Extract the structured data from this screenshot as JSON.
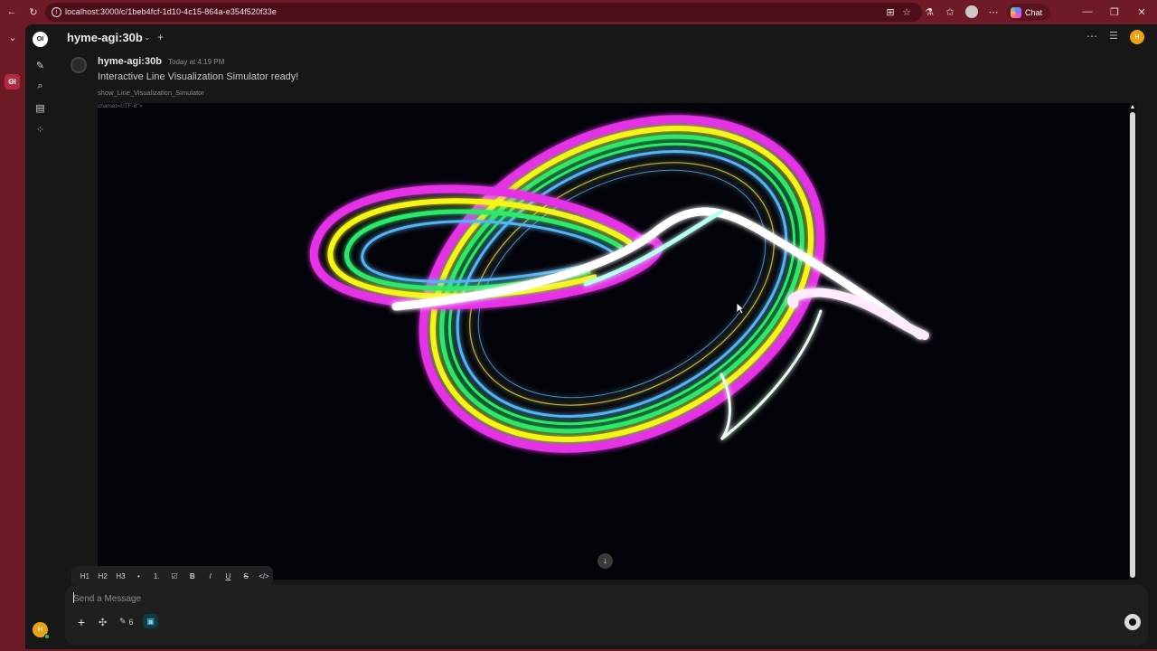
{
  "browser": {
    "url": "localhost:3000/c/1beb4fcf-1d10-4c15-864a-e354f520f33e",
    "chat_button": "Chat",
    "info_icon": "info-icon",
    "back_icon": "back-arrow-icon",
    "refresh_icon": "refresh-icon"
  },
  "header": {
    "model_name": "hyme-agi:30b",
    "user_initial": "H"
  },
  "message": {
    "author": "hyme-agi:30b",
    "time": "Today at 4:19 PM",
    "text": "Interactive Line Visualization Simulator ready!",
    "sub_label": "show_Line_Visualization_Simulator",
    "code_snippet": "charset=UTF-8\">"
  },
  "sidebar": {
    "logo": "OI",
    "user_initial": "H"
  },
  "composer": {
    "placeholder": "Send a Message",
    "tool_count": "6",
    "format_buttons": [
      "H1",
      "H2",
      "H3",
      "•",
      "1.",
      "☑",
      "B",
      "I",
      "U",
      "S",
      "</>"
    ]
  },
  "colors": {
    "magenta": "#e632e6",
    "yellow": "#f5f514",
    "green": "#2ee86b",
    "blue": "#56b4f2",
    "white": "#ffffff",
    "accent": "#e8a317"
  }
}
